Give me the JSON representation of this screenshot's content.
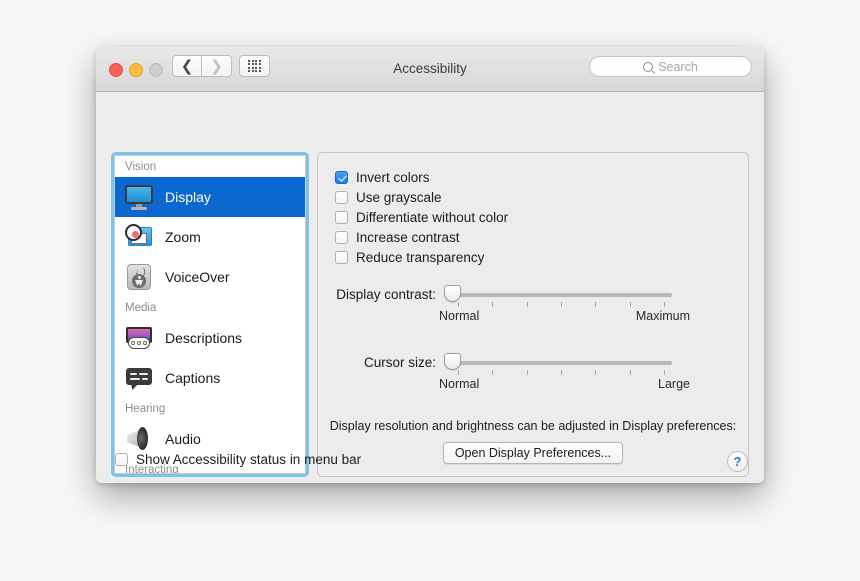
{
  "window": {
    "title": "Accessibility",
    "traffic_lights": [
      "close",
      "minimize",
      "zoom"
    ],
    "nav": {
      "back_icon": "chevron-left-icon",
      "forward_icon": "chevron-right-icon",
      "grid_icon": "show-all-grid-icon"
    },
    "search": {
      "placeholder": "Search",
      "icon": "search-icon",
      "value": ""
    }
  },
  "sidebar": {
    "groups": [
      {
        "label": "Vision",
        "items": [
          {
            "label": "Display",
            "icon": "display-monitor-icon",
            "selected": true
          },
          {
            "label": "Zoom",
            "icon": "zoom-magnifier-icon",
            "selected": false
          },
          {
            "label": "VoiceOver",
            "icon": "voiceover-icon",
            "selected": false
          }
        ]
      },
      {
        "label": "Media",
        "items": [
          {
            "label": "Descriptions",
            "icon": "descriptions-icon",
            "selected": false
          },
          {
            "label": "Captions",
            "icon": "captions-icon",
            "selected": false
          }
        ]
      },
      {
        "label": "Hearing",
        "items": [
          {
            "label": "Audio",
            "icon": "audio-speaker-icon",
            "selected": false
          }
        ]
      },
      {
        "label": "Interacting",
        "items": []
      }
    ]
  },
  "panel": {
    "checkboxes": [
      {
        "label": "Invert colors",
        "checked": true
      },
      {
        "label": "Use grayscale",
        "checked": false
      },
      {
        "label": "Differentiate without color",
        "checked": false
      },
      {
        "label": "Increase contrast",
        "checked": false
      },
      {
        "label": "Reduce transparency",
        "checked": false
      }
    ],
    "sliders": [
      {
        "title": "Display contrast:",
        "min_label": "Normal",
        "max_label": "Maximum",
        "value": 0,
        "tick_count": 7
      },
      {
        "title": "Cursor size:",
        "min_label": "Normal",
        "max_label": "Large",
        "value": 0,
        "tick_count": 7
      }
    ],
    "note": "Display resolution and brightness can be adjusted in Display preferences:",
    "open_display_button": "Open Display Preferences..."
  },
  "footer": {
    "status_checkbox": {
      "label": "Show Accessibility status in menu bar",
      "checked": false
    },
    "help_label": "?"
  },
  "colors": {
    "selection_blue": "#0a68d0",
    "focus_ring": "#7cc3ec",
    "checkbox_blue": "#1a7ee8",
    "help_blue": "#1d7ef0"
  }
}
